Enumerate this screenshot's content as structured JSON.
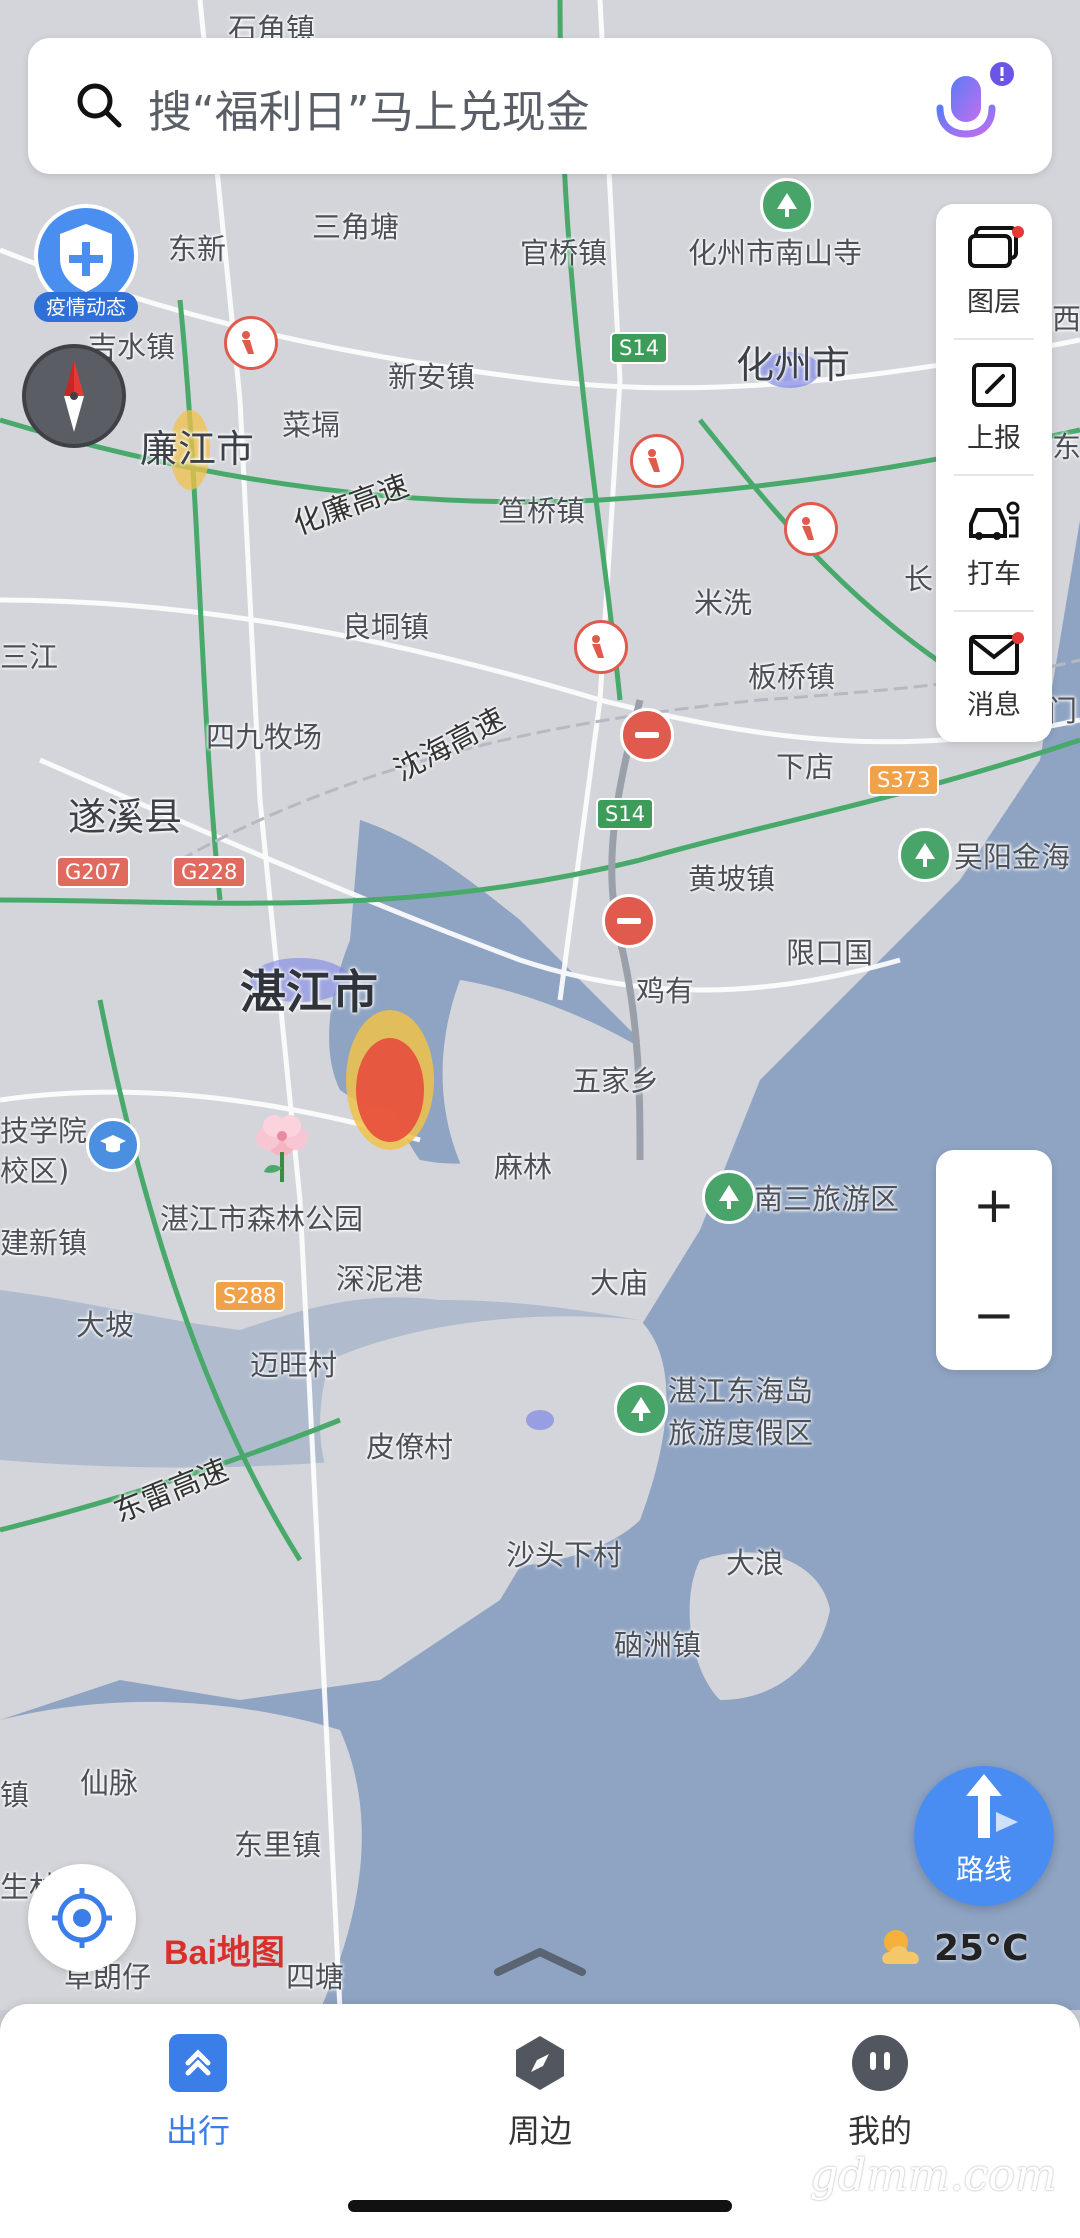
{
  "search": {
    "placeholder": "搜“福利日”马上兑现金"
  },
  "epidemic": {
    "label": "疫情动态"
  },
  "toolbar": [
    {
      "label": "图层",
      "icon": "layers-icon"
    },
    {
      "label": "上报",
      "icon": "report-icon"
    },
    {
      "label": "打车",
      "icon": "taxi-icon"
    },
    {
      "label": "消息",
      "icon": "message-icon"
    }
  ],
  "zoom": {
    "in": "+",
    "out": "−"
  },
  "route": {
    "label": "路线"
  },
  "logo": {
    "text": "Bai地图"
  },
  "weather": {
    "temp": "25°C",
    "icon": "partly-cloudy-icon"
  },
  "nav": [
    {
      "label": "出行",
      "icon": "travel-icon",
      "active": true
    },
    {
      "label": "周边",
      "icon": "nearby-compass-icon",
      "active": false
    },
    {
      "label": "我的",
      "icon": "profile-icon",
      "active": false
    }
  ],
  "watermark": "gdmm.com",
  "colors": {
    "accent": "#3b7ee8",
    "heat": "#e74c3c"
  },
  "map": {
    "cities": [
      "湛江市",
      "廉江市",
      "化州市",
      "遂溪县"
    ],
    "towns": [
      "石角镇",
      "三角塘",
      "东新",
      "官桥镇",
      "化州市南山寺",
      "吉水镇",
      "新安镇",
      "菜塥",
      "笪桥镇",
      "良垌镇",
      "米洗",
      "板桥镇",
      "四九牧场",
      "下店",
      "吴阳金海",
      "黄坡镇",
      "限口国",
      "鸡有",
      "五家乡",
      "麻林",
      "南三旅游区",
      "湛江市森林公园",
      "深泥港",
      "大庙",
      "大坡",
      "迈旺村",
      "湛江东海岛",
      "旅游度假区",
      "皮僚村",
      "沙头下村",
      "大浪",
      "硇洲镇",
      "仙脉",
      "东里镇",
      "建新镇",
      "技学院",
      "校区)",
      "三江",
      "长",
      "镇",
      "四塘",
      "草朗仔",
      "生林",
      "西",
      "东",
      "门"
    ],
    "highways": [
      "化廉高速",
      "沈海高速",
      "东雷高速"
    ],
    "shields": [
      {
        "label": "S14",
        "type": "s"
      },
      {
        "label": "S14",
        "type": "s"
      },
      {
        "label": "G207",
        "type": "g"
      },
      {
        "label": "G228",
        "type": "g"
      },
      {
        "label": "S373",
        "type": "o"
      },
      {
        "label": "S288",
        "type": "o"
      }
    ]
  }
}
